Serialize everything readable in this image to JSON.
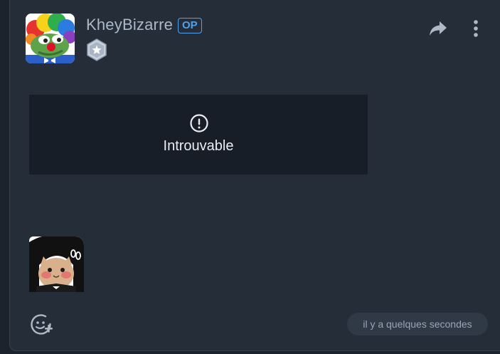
{
  "post": {
    "author": "KheyBizarre",
    "op_badge": "OP",
    "rank_icon": "silver-star-badge-icon",
    "embed_status": "Introuvable",
    "timestamp": "il y a quelques secondes"
  },
  "icons": {
    "share": "share-arrow-icon",
    "more": "more-vertical-icon",
    "error": "exclamation-circle-icon",
    "react": "add-reaction-icon"
  },
  "colors": {
    "background": "#1d232c",
    "card": "#252d39",
    "embed_bg": "#171e27",
    "accent": "#4ea3f0",
    "username": "#aab8c8",
    "icon": "#aeb8c6"
  }
}
